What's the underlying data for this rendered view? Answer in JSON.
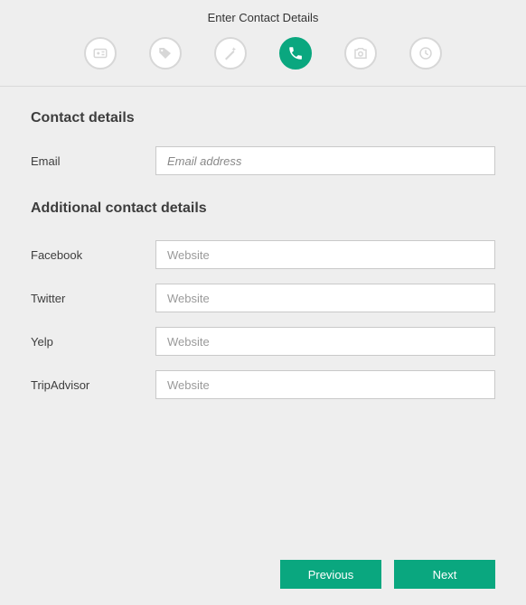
{
  "header": {
    "title": "Enter Contact Details",
    "steps": [
      {
        "icon": "id-card-icon",
        "active": false
      },
      {
        "icon": "tag-icon",
        "active": false
      },
      {
        "icon": "wand-icon",
        "active": false
      },
      {
        "icon": "phone-icon",
        "active": true
      },
      {
        "icon": "camera-icon",
        "active": false
      },
      {
        "icon": "clock-icon",
        "active": false
      }
    ]
  },
  "sections": {
    "contact": {
      "title": "Contact details",
      "email": {
        "label": "Email",
        "placeholder": "Email address",
        "value": ""
      }
    },
    "additional": {
      "title": "Additional contact details",
      "facebook": {
        "label": "Facebook",
        "placeholder": "Website",
        "value": ""
      },
      "twitter": {
        "label": "Twitter",
        "placeholder": "Website",
        "value": ""
      },
      "yelp": {
        "label": "Yelp",
        "placeholder": "Website",
        "value": ""
      },
      "tripadvisor": {
        "label": "TripAdvisor",
        "placeholder": "Website",
        "value": ""
      }
    }
  },
  "footer": {
    "previous": "Previous",
    "next": "Next"
  }
}
